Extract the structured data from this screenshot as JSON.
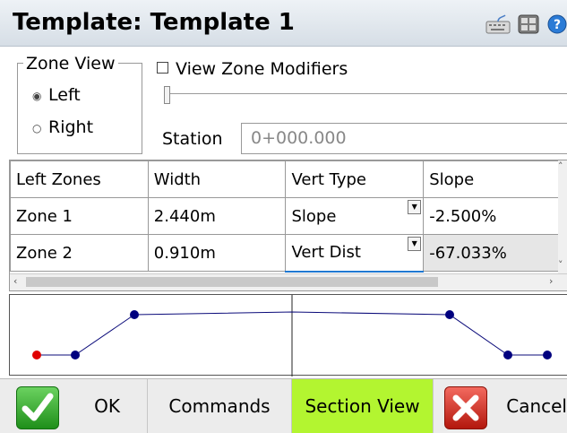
{
  "window": {
    "title": "Template: Template 1"
  },
  "zone_view": {
    "legend": "Zone View",
    "options": [
      "Left",
      "Right"
    ],
    "selected": "Left"
  },
  "view_zone_modifiers": {
    "label": "View Zone Modifiers",
    "checked": false
  },
  "station": {
    "label": "Station",
    "value": "0+000.000"
  },
  "grid": {
    "columns": [
      "Left Zones",
      "Width",
      "Vert Type",
      "Slope"
    ],
    "rows": [
      {
        "zone": "Zone 1",
        "width": "2.440m",
        "vert_type": "Slope",
        "slope": "-2.500%"
      },
      {
        "zone": "Zone 2",
        "width": "0.910m",
        "vert_type": "Vert Dist",
        "slope": "-67.033%"
      }
    ]
  },
  "colors": {
    "selected_button": "#b3f530",
    "profile_line": "#0b0b7a",
    "profile_point": "#00007f",
    "current_point": "#e00000"
  },
  "toolbar": {
    "ok": "OK",
    "commands": "Commands",
    "section_view": "Section View",
    "cancel": "Cancel"
  },
  "icons": [
    "keyboard-icon",
    "calculator-icon",
    "help-icon",
    "ok-check-icon",
    "cancel-x-icon"
  ]
}
